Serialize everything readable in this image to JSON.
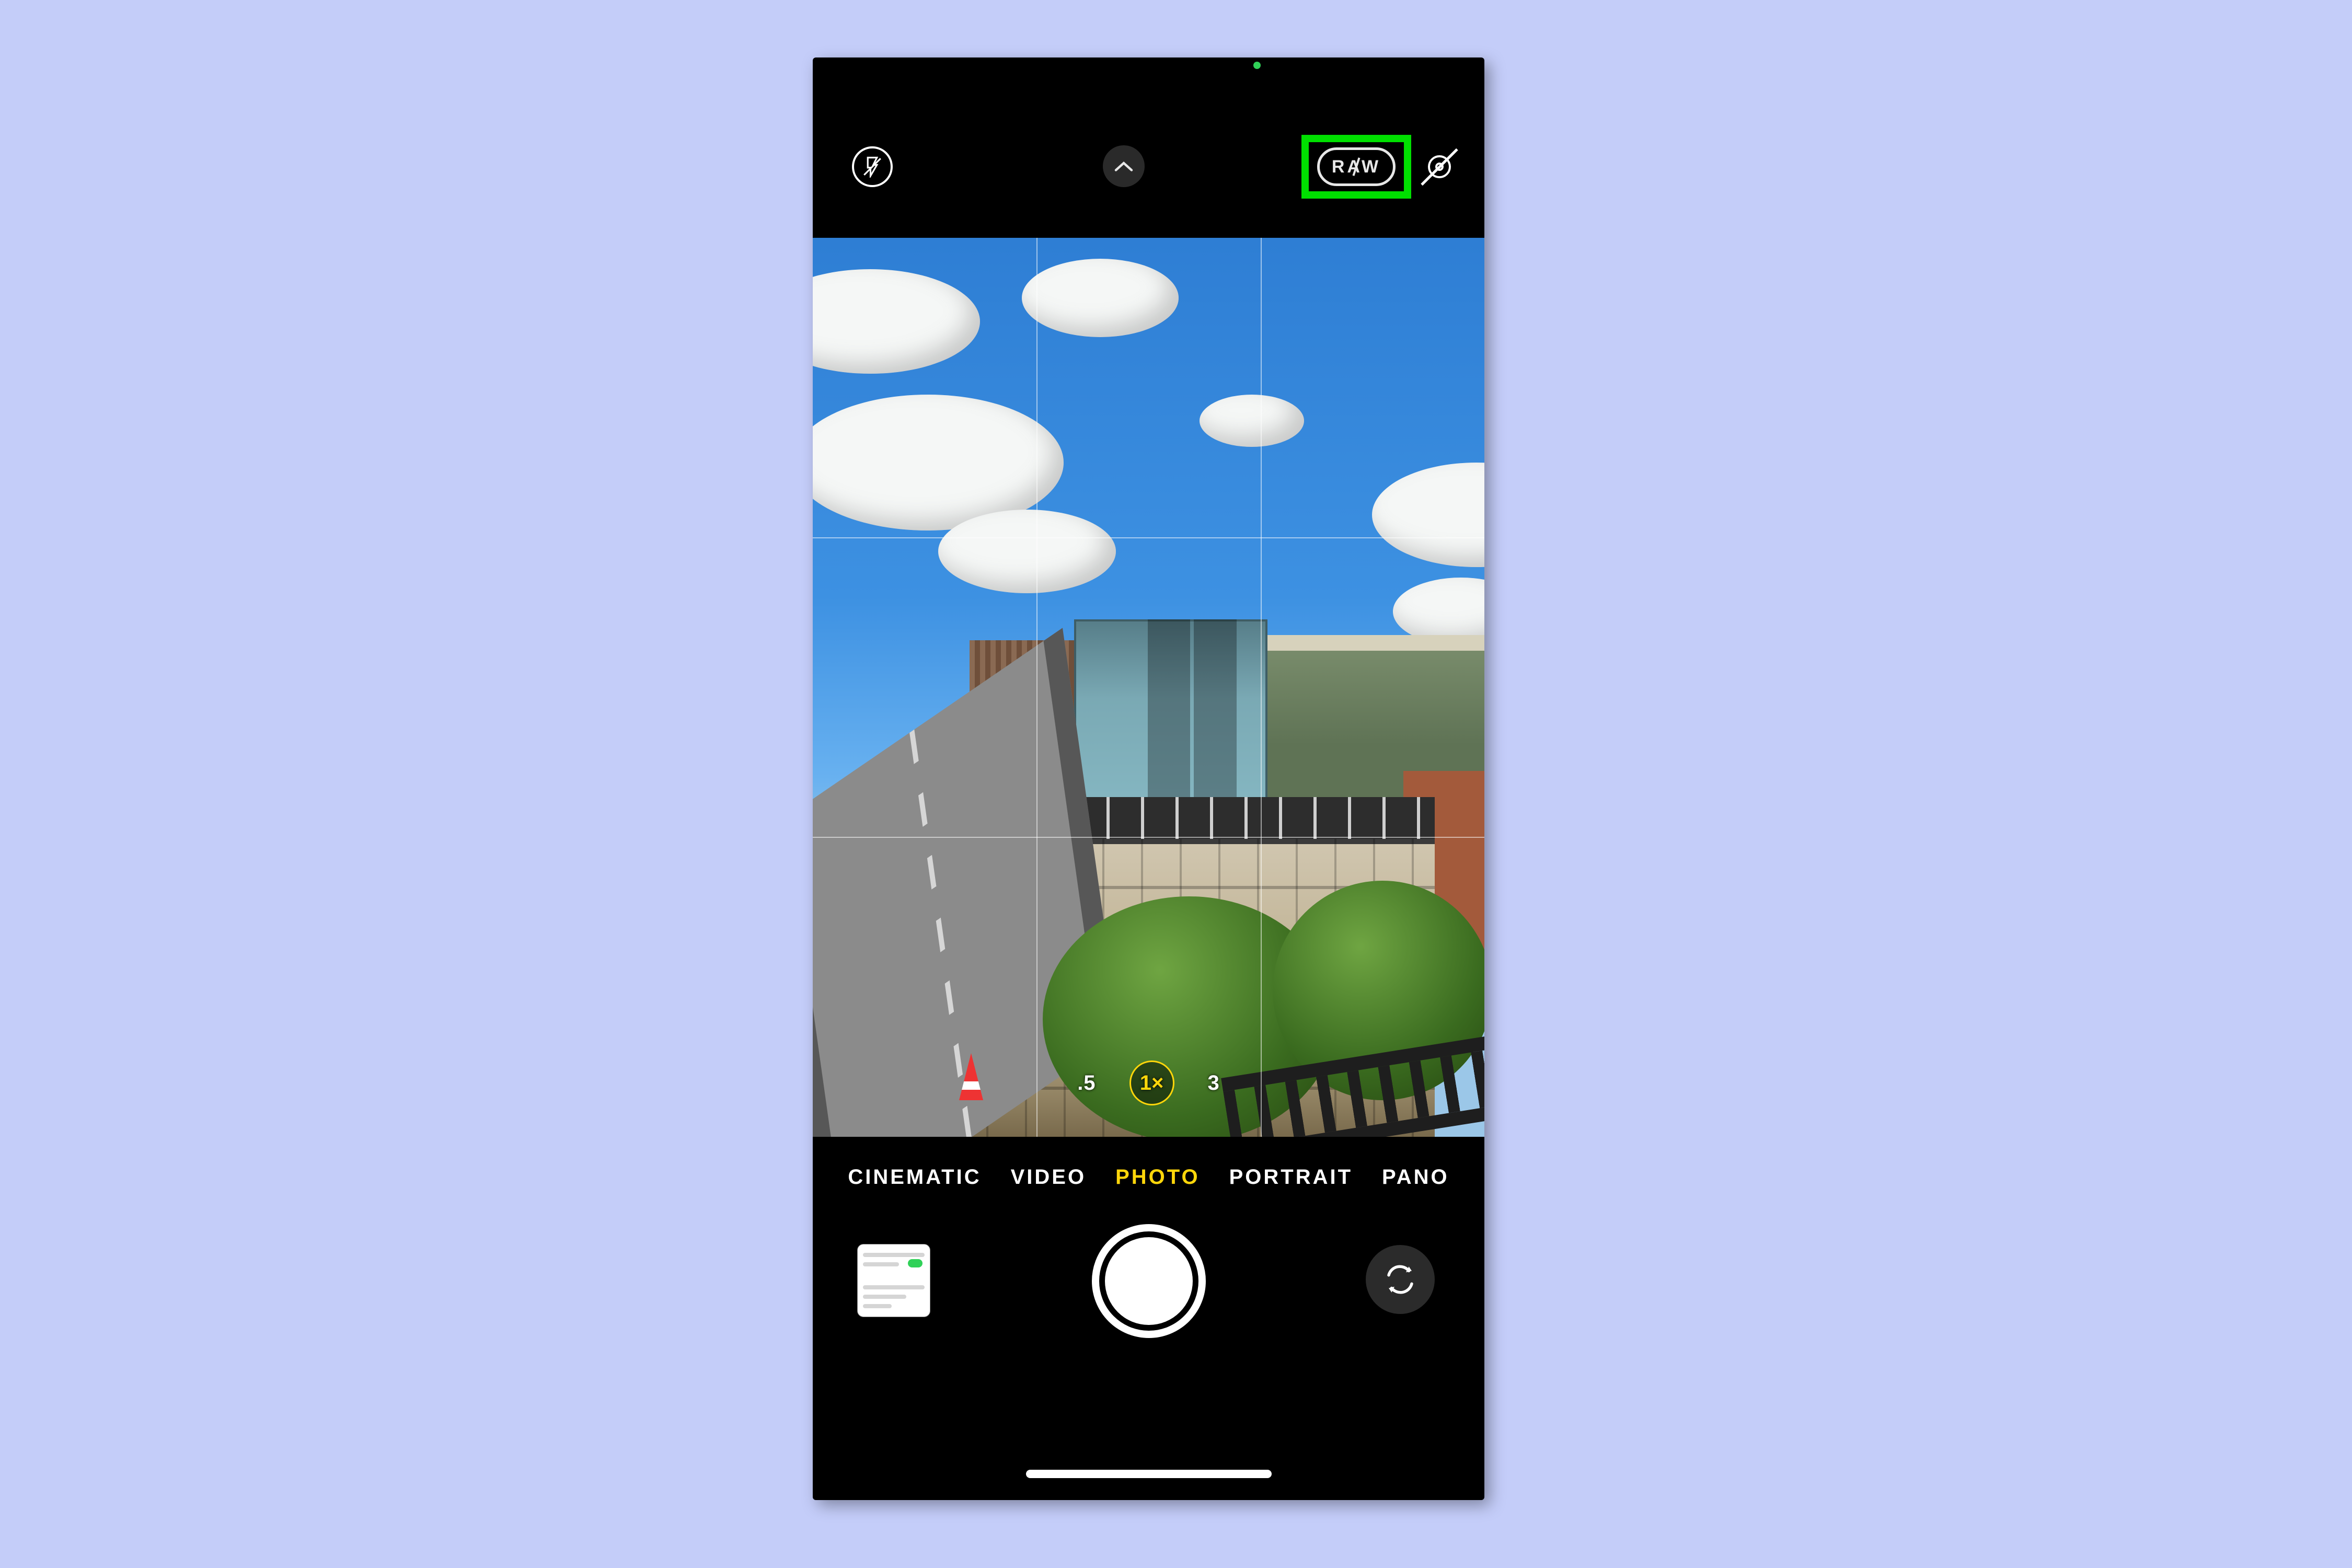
{
  "statusbar": {
    "camera_active_color": "#30d158"
  },
  "topbar": {
    "flash_state": "off",
    "raw_label": "RAW",
    "raw_enabled": false,
    "live_photo_enabled": false,
    "highlight_color": "#00e000"
  },
  "viewfinder": {
    "grid_enabled": true,
    "scene_description": "Rooftop view of residential and office buildings under partly cloudy blue sky",
    "zoom_levels": [
      {
        "label": ".5",
        "active": false
      },
      {
        "label": "1×",
        "active": true
      },
      {
        "label": "3",
        "active": false
      }
    ]
  },
  "modes": [
    {
      "label": "CINEMATIC",
      "active": false
    },
    {
      "label": "VIDEO",
      "active": false
    },
    {
      "label": "PHOTO",
      "active": true
    },
    {
      "label": "PORTRAIT",
      "active": false
    },
    {
      "label": "PANO",
      "active": false
    }
  ],
  "controls": {
    "last_photo_thumbnail": "settings-screenshot",
    "home_indicator_color": "#ffffff"
  },
  "colors": {
    "mode_active": "#ffd60a",
    "background_page": "#C4CDF9"
  }
}
